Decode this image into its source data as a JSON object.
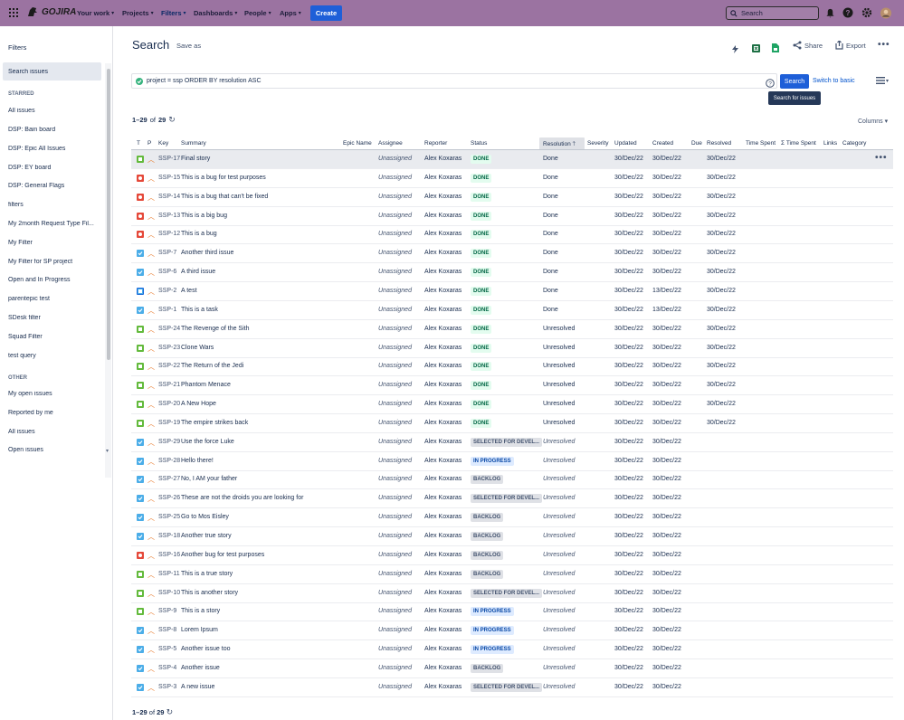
{
  "topnav": {
    "logo_text": "GOJIRA",
    "items": [
      {
        "label": "Your work"
      },
      {
        "label": "Projects"
      },
      {
        "label": "Filters"
      },
      {
        "label": "Dashboards"
      },
      {
        "label": "People"
      },
      {
        "label": "Apps"
      }
    ],
    "create_label": "Create",
    "search_placeholder": "Search"
  },
  "sidebar": {
    "title": "Filters",
    "search_issues": "Search issues",
    "starred_heading": "STARRED",
    "starred": [
      "All issues",
      "DSP: Bain board",
      "DSP: Epic All Issues",
      "DSP: EY board",
      "DSP: General Flags",
      "filters",
      "My 2month Request Type Fil...",
      "My Filter",
      "My Filter for SP project",
      "Open and In Progress",
      "parentepic test",
      "SDesk filter",
      "Squad Filter",
      "test query"
    ],
    "other_heading": "OTHER",
    "other": [
      "My open issues",
      "Reported by me",
      "All issues",
      "Open issues"
    ]
  },
  "main": {
    "title": "Search",
    "save_as": "Save as",
    "share": "Share",
    "export": "Export",
    "query": "project = ssp ORDER BY resolution ASC",
    "search_button": "Search",
    "switch_basic": "Switch to basic",
    "tooltip": "Search for issues",
    "count_prefix": "1–29",
    "count_of": "of",
    "count_total": "29",
    "columns_label": "Columns"
  },
  "table": {
    "headers": {
      "t": "T",
      "p": "P",
      "key": "Key",
      "summary": "Summary",
      "epic": "Epic Name",
      "assignee": "Assignee",
      "reporter": "Reporter",
      "status": "Status",
      "resolution": "Resolution",
      "severity": "Severity",
      "updated": "Updated",
      "created": "Created",
      "due": "Due",
      "resolved": "Resolved",
      "time_spent": "Time Spent",
      "sum_time_spent": "Σ Time Spent",
      "links": "Links",
      "category": "Category"
    },
    "rows": [
      {
        "type": "story",
        "key": "SSP-17",
        "summary": "Final story",
        "assignee": "Unassigned",
        "reporter": "Alex Koxaras",
        "status": "DONE",
        "status_kind": "done",
        "resolution": "Done",
        "updated": "30/Dec/22",
        "created": "30/Dec/22",
        "resolved": "30/Dec/22"
      },
      {
        "type": "bug",
        "key": "SSP-15",
        "summary": "This is a bug for test purposes",
        "assignee": "Unassigned",
        "reporter": "Alex Koxaras",
        "status": "DONE",
        "status_kind": "done",
        "resolution": "Done",
        "updated": "30/Dec/22",
        "created": "30/Dec/22",
        "resolved": "30/Dec/22"
      },
      {
        "type": "bug",
        "key": "SSP-14",
        "summary": "This is a bug that can't be fixed",
        "assignee": "Unassigned",
        "reporter": "Alex Koxaras",
        "status": "DONE",
        "status_kind": "done",
        "resolution": "Done",
        "updated": "30/Dec/22",
        "created": "30/Dec/22",
        "resolved": "30/Dec/22"
      },
      {
        "type": "bug",
        "key": "SSP-13",
        "summary": "This is a big bug",
        "assignee": "Unassigned",
        "reporter": "Alex Koxaras",
        "status": "DONE",
        "status_kind": "done",
        "resolution": "Done",
        "updated": "30/Dec/22",
        "created": "30/Dec/22",
        "resolved": "30/Dec/22"
      },
      {
        "type": "bug",
        "key": "SSP-12",
        "summary": "This is a bug",
        "assignee": "Unassigned",
        "reporter": "Alex Koxaras",
        "status": "DONE",
        "status_kind": "done",
        "resolution": "Done",
        "updated": "30/Dec/22",
        "created": "30/Dec/22",
        "resolved": "30/Dec/22"
      },
      {
        "type": "task",
        "key": "SSP-7",
        "summary": "Another third issue",
        "assignee": "Unassigned",
        "reporter": "Alex Koxaras",
        "status": "DONE",
        "status_kind": "done",
        "resolution": "Done",
        "updated": "30/Dec/22",
        "created": "30/Dec/22",
        "resolved": "30/Dec/22"
      },
      {
        "type": "task",
        "key": "SSP-6",
        "summary": "A third issue",
        "assignee": "Unassigned",
        "reporter": "Alex Koxaras",
        "status": "DONE",
        "status_kind": "done",
        "resolution": "Done",
        "updated": "30/Dec/22",
        "created": "30/Dec/22",
        "resolved": "30/Dec/22"
      },
      {
        "type": "subtask",
        "key": "SSP-2",
        "summary": "A test",
        "assignee": "Unassigned",
        "reporter": "Alex Koxaras",
        "status": "DONE",
        "status_kind": "done",
        "resolution": "Done",
        "updated": "30/Dec/22",
        "created": "13/Dec/22",
        "resolved": "30/Dec/22"
      },
      {
        "type": "task",
        "key": "SSP-1",
        "summary": "This is a task",
        "assignee": "Unassigned",
        "reporter": "Alex Koxaras",
        "status": "DONE",
        "status_kind": "done",
        "resolution": "Done",
        "updated": "30/Dec/22",
        "created": "13/Dec/22",
        "resolved": "30/Dec/22"
      },
      {
        "type": "story",
        "key": "SSP-24",
        "summary": "The Revenge of the Sith",
        "assignee": "Unassigned",
        "reporter": "Alex Koxaras",
        "status": "DONE",
        "status_kind": "done",
        "resolution": "Unresolved",
        "updated": "30/Dec/22",
        "created": "30/Dec/22",
        "resolved": "30/Dec/22"
      },
      {
        "type": "story",
        "key": "SSP-23",
        "summary": "Clone Wars",
        "assignee": "Unassigned",
        "reporter": "Alex Koxaras",
        "status": "DONE",
        "status_kind": "done",
        "resolution": "Unresolved",
        "updated": "30/Dec/22",
        "created": "30/Dec/22",
        "resolved": "30/Dec/22"
      },
      {
        "type": "story",
        "key": "SSP-22",
        "summary": "The Return of the Jedi",
        "assignee": "Unassigned",
        "reporter": "Alex Koxaras",
        "status": "DONE",
        "status_kind": "done",
        "resolution": "Unresolved",
        "updated": "30/Dec/22",
        "created": "30/Dec/22",
        "resolved": "30/Dec/22"
      },
      {
        "type": "story",
        "key": "SSP-21",
        "summary": "Phantom Menace",
        "assignee": "Unassigned",
        "reporter": "Alex Koxaras",
        "status": "DONE",
        "status_kind": "done",
        "resolution": "Unresolved",
        "updated": "30/Dec/22",
        "created": "30/Dec/22",
        "resolved": "30/Dec/22"
      },
      {
        "type": "story",
        "key": "SSP-20",
        "summary": "A New Hope",
        "assignee": "Unassigned",
        "reporter": "Alex Koxaras",
        "status": "DONE",
        "status_kind": "done",
        "resolution": "Unresolved",
        "updated": "30/Dec/22",
        "created": "30/Dec/22",
        "resolved": "30/Dec/22"
      },
      {
        "type": "story",
        "key": "SSP-19",
        "summary": "The empire strikes back",
        "assignee": "Unassigned",
        "reporter": "Alex Koxaras",
        "status": "DONE",
        "status_kind": "done",
        "resolution": "Unresolved",
        "updated": "30/Dec/22",
        "created": "30/Dec/22",
        "resolved": "30/Dec/22"
      },
      {
        "type": "task",
        "key": "SSP-29",
        "summary": "Use the force Luke",
        "assignee": "Unassigned",
        "reporter": "Alex Koxaras",
        "status": "SELECTED FOR DEVEL...",
        "status_kind": "backlog",
        "resolution": "Unresolved",
        "updated": "30/Dec/22",
        "created": "30/Dec/22",
        "resolved": ""
      },
      {
        "type": "task",
        "key": "SSP-28",
        "summary": "Hello there!",
        "assignee": "Unassigned",
        "reporter": "Alex Koxaras",
        "status": "IN PROGRESS",
        "status_kind": "progress",
        "resolution": "Unresolved",
        "updated": "30/Dec/22",
        "created": "30/Dec/22",
        "resolved": ""
      },
      {
        "type": "task",
        "key": "SSP-27",
        "summary": "No, I AM your father",
        "assignee": "Unassigned",
        "reporter": "Alex Koxaras",
        "status": "BACKLOG",
        "status_kind": "backlog",
        "resolution": "Unresolved",
        "updated": "30/Dec/22",
        "created": "30/Dec/22",
        "resolved": ""
      },
      {
        "type": "task",
        "key": "SSP-26",
        "summary": "These are not the droids you are looking for",
        "assignee": "Unassigned",
        "reporter": "Alex Koxaras",
        "status": "SELECTED FOR DEVEL...",
        "status_kind": "backlog",
        "resolution": "Unresolved",
        "updated": "30/Dec/22",
        "created": "30/Dec/22",
        "resolved": ""
      },
      {
        "type": "task",
        "key": "SSP-25",
        "summary": "Go to Mos Eisley",
        "assignee": "Unassigned",
        "reporter": "Alex Koxaras",
        "status": "BACKLOG",
        "status_kind": "backlog",
        "resolution": "Unresolved",
        "updated": "30/Dec/22",
        "created": "30/Dec/22",
        "resolved": ""
      },
      {
        "type": "task",
        "key": "SSP-18",
        "summary": "Another true story",
        "assignee": "Unassigned",
        "reporter": "Alex Koxaras",
        "status": "BACKLOG",
        "status_kind": "backlog",
        "resolution": "Unresolved",
        "updated": "30/Dec/22",
        "created": "30/Dec/22",
        "resolved": ""
      },
      {
        "type": "bug",
        "key": "SSP-16",
        "summary": "Another bug for test purposes",
        "assignee": "Unassigned",
        "reporter": "Alex Koxaras",
        "status": "BACKLOG",
        "status_kind": "backlog",
        "resolution": "Unresolved",
        "updated": "30/Dec/22",
        "created": "30/Dec/22",
        "resolved": ""
      },
      {
        "type": "story",
        "key": "SSP-11",
        "summary": "This is a true story",
        "assignee": "Unassigned",
        "reporter": "Alex Koxaras",
        "status": "BACKLOG",
        "status_kind": "backlog",
        "resolution": "Unresolved",
        "updated": "30/Dec/22",
        "created": "30/Dec/22",
        "resolved": ""
      },
      {
        "type": "story",
        "key": "SSP-10",
        "summary": "This is another story",
        "assignee": "Unassigned",
        "reporter": "Alex Koxaras",
        "status": "SELECTED FOR DEVEL...",
        "status_kind": "backlog",
        "resolution": "Unresolved",
        "updated": "30/Dec/22",
        "created": "30/Dec/22",
        "resolved": ""
      },
      {
        "type": "story",
        "key": "SSP-9",
        "summary": "This is a story",
        "assignee": "Unassigned",
        "reporter": "Alex Koxaras",
        "status": "IN PROGRESS",
        "status_kind": "progress",
        "resolution": "Unresolved",
        "updated": "30/Dec/22",
        "created": "30/Dec/22",
        "resolved": ""
      },
      {
        "type": "task",
        "key": "SSP-8",
        "summary": "Lorem Ipsum",
        "assignee": "Unassigned",
        "reporter": "Alex Koxaras",
        "status": "IN PROGRESS",
        "status_kind": "progress",
        "resolution": "Unresolved",
        "updated": "30/Dec/22",
        "created": "30/Dec/22",
        "resolved": ""
      },
      {
        "type": "task",
        "key": "SSP-5",
        "summary": "Another issue too",
        "assignee": "Unassigned",
        "reporter": "Alex Koxaras",
        "status": "IN PROGRESS",
        "status_kind": "progress",
        "resolution": "Unresolved",
        "updated": "30/Dec/22",
        "created": "30/Dec/22",
        "resolved": ""
      },
      {
        "type": "task",
        "key": "SSP-4",
        "summary": "Another issue",
        "assignee": "Unassigned",
        "reporter": "Alex Koxaras",
        "status": "BACKLOG",
        "status_kind": "backlog",
        "resolution": "Unresolved",
        "updated": "30/Dec/22",
        "created": "30/Dec/22",
        "resolved": ""
      },
      {
        "type": "task",
        "key": "SSP-3",
        "summary": "A new issue",
        "assignee": "Unassigned",
        "reporter": "Alex Koxaras",
        "status": "SELECTED FOR DEVEL...",
        "status_kind": "backlog",
        "resolution": "Unresolved",
        "updated": "30/Dec/22",
        "created": "30/Dec/22",
        "resolved": ""
      }
    ]
  },
  "colors": {
    "topbar": "#9b73a1",
    "primary": "#1e5fd8",
    "story": "#63ba3c",
    "bug": "#e5493a",
    "task": "#4bade8"
  }
}
